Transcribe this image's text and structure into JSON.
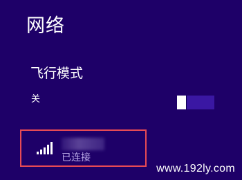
{
  "header": {
    "title": "网络"
  },
  "airplane_mode": {
    "label": "飞行模式",
    "state_label": "关",
    "enabled": false
  },
  "networks": [
    {
      "name": "",
      "status": "已连接",
      "signal_icon": "wifi-signal-full-icon",
      "signal_bars": 5,
      "highlighted": true
    }
  ],
  "watermark": {
    "text": "www.192ly.com"
  },
  "colors": {
    "background": "#1e0068",
    "toggle_track": "#3a17a3",
    "highlight_border": "#e74a55",
    "status_text": "#b9a9e6"
  }
}
